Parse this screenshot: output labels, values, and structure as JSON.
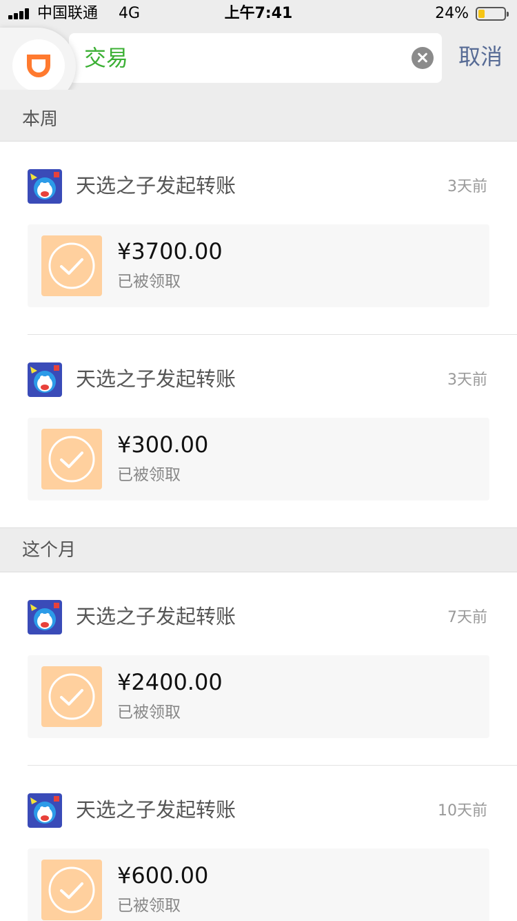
{
  "status_bar": {
    "carrier": "中国联通",
    "network": "4G",
    "time": "上午7:41",
    "battery_percent": "24%",
    "battery_level": 0.24,
    "battery_color": "#f6c515"
  },
  "search": {
    "query": "交易",
    "cancel_label": "取消",
    "clear_icon": "clear-icon",
    "app_icon": "didi-logo-icon"
  },
  "sections": [
    {
      "title": "本周"
    },
    {
      "title": "这个月"
    }
  ],
  "items": [
    {
      "title": "天选之子发起转账",
      "time": "3天前",
      "amount": "¥3700.00",
      "status": "已被领取"
    },
    {
      "title": "天选之子发起转账",
      "time": "3天前",
      "amount": "¥300.00",
      "status": "已被领取"
    },
    {
      "title": "天选之子发起转账",
      "time": "7天前",
      "amount": "¥2400.00",
      "status": "已被领取"
    },
    {
      "title": "天选之子发起转账",
      "time": "10天前",
      "amount": "¥600.00",
      "status": "已被领取"
    }
  ],
  "colors": {
    "search_text": "#3cb035",
    "cancel": "#576b95",
    "check_bg": "#ffd09e",
    "didi_orange": "#ff7a2f"
  }
}
